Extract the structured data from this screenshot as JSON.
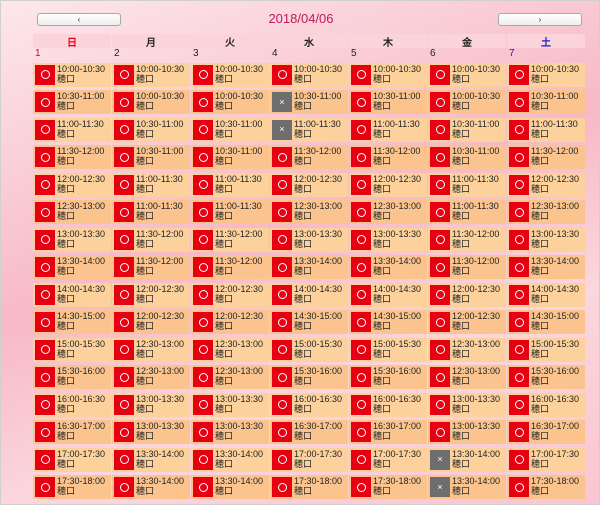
{
  "nav": {
    "prev_label": "‹",
    "next_label": "›"
  },
  "title": "2018/04/06",
  "colors": {
    "available": "#e60012",
    "unavailable": "#6e6e6e",
    "slot_bg": "#fdd19c",
    "header_bg": "#fbd4d9"
  },
  "days": [
    {
      "weekday": "日",
      "date": "1",
      "kind": "sun",
      "slots": [
        {
          "time": "10:00-10:30",
          "location": "穂口",
          "available": true
        },
        {
          "time": "10:30-11:00",
          "location": "穂口",
          "available": true
        },
        {
          "time": "11:00-11:30",
          "location": "穂口",
          "available": true
        },
        {
          "time": "11:30-12:00",
          "location": "穂口",
          "available": true
        },
        {
          "time": "12:00-12:30",
          "location": "穂口",
          "available": true
        },
        {
          "time": "12:30-13:00",
          "location": "穂口",
          "available": true
        },
        {
          "time": "13:00-13:30",
          "location": "穂口",
          "available": true
        },
        {
          "time": "13:30-14:00",
          "location": "穂口",
          "available": true
        },
        {
          "time": "14:00-14:30",
          "location": "穂口",
          "available": true
        },
        {
          "time": "14:30-15:00",
          "location": "穂口",
          "available": true
        },
        {
          "time": "15:00-15:30",
          "location": "穂口",
          "available": true
        },
        {
          "time": "15:30-16:00",
          "location": "穂口",
          "available": true
        },
        {
          "time": "16:00-16:30",
          "location": "穂口",
          "available": true
        },
        {
          "time": "16:30-17:00",
          "location": "穂口",
          "available": true
        },
        {
          "time": "17:00-17:30",
          "location": "穂口",
          "available": true
        },
        {
          "time": "17:30-18:00",
          "location": "穂口",
          "available": true
        }
      ]
    },
    {
      "weekday": "月",
      "date": "2",
      "kind": "wd",
      "slots": [
        {
          "time": "10:00-10:30",
          "location": "穂口",
          "available": true
        },
        {
          "time": "10:00-10:30",
          "location": "穂口",
          "available": true
        },
        {
          "time": "10:30-11:00",
          "location": "穂口",
          "available": true
        },
        {
          "time": "10:30-11:00",
          "location": "穂口",
          "available": true
        },
        {
          "time": "11:00-11:30",
          "location": "穂口",
          "available": true
        },
        {
          "time": "11:00-11:30",
          "location": "穂口",
          "available": true
        },
        {
          "time": "11:30-12:00",
          "location": "穂口",
          "available": true
        },
        {
          "time": "11:30-12:00",
          "location": "穂口",
          "available": true
        },
        {
          "time": "12:00-12:30",
          "location": "穂口",
          "available": true
        },
        {
          "time": "12:00-12:30",
          "location": "穂口",
          "available": true
        },
        {
          "time": "12:30-13:00",
          "location": "穂口",
          "available": true
        },
        {
          "time": "12:30-13:00",
          "location": "穂口",
          "available": true
        },
        {
          "time": "13:00-13:30",
          "location": "穂口",
          "available": true
        },
        {
          "time": "13:00-13:30",
          "location": "穂口",
          "available": true
        },
        {
          "time": "13:30-14:00",
          "location": "穂口",
          "available": true
        },
        {
          "time": "13:30-14:00",
          "location": "穂口",
          "available": true
        }
      ]
    },
    {
      "weekday": "火",
      "date": "3",
      "kind": "wd",
      "slots": [
        {
          "time": "10:00-10:30",
          "location": "穂口",
          "available": true
        },
        {
          "time": "10:00-10:30",
          "location": "穂口",
          "available": true
        },
        {
          "time": "10:30-11:00",
          "location": "穂口",
          "available": true
        },
        {
          "time": "10:30-11:00",
          "location": "穂口",
          "available": true
        },
        {
          "time": "11:00-11:30",
          "location": "穂口",
          "available": true
        },
        {
          "time": "11:00-11:30",
          "location": "穂口",
          "available": true
        },
        {
          "time": "11:30-12:00",
          "location": "穂口",
          "available": true
        },
        {
          "time": "11:30-12:00",
          "location": "穂口",
          "available": true
        },
        {
          "time": "12:00-12:30",
          "location": "穂口",
          "available": true
        },
        {
          "time": "12:00-12:30",
          "location": "穂口",
          "available": true
        },
        {
          "time": "12:30-13:00",
          "location": "穂口",
          "available": true
        },
        {
          "time": "12:30-13:00",
          "location": "穂口",
          "available": true
        },
        {
          "time": "13:00-13:30",
          "location": "穂口",
          "available": true
        },
        {
          "time": "13:00-13:30",
          "location": "穂口",
          "available": true
        },
        {
          "time": "13:30-14:00",
          "location": "穂口",
          "available": true
        },
        {
          "time": "13:30-14:00",
          "location": "穂口",
          "available": true
        }
      ]
    },
    {
      "weekday": "水",
      "date": "4",
      "kind": "wd",
      "slots": [
        {
          "time": "10:00-10:30",
          "location": "穂口",
          "available": true
        },
        {
          "time": "10:30-11:00",
          "location": "穂口",
          "available": false
        },
        {
          "time": "11:00-11:30",
          "location": "穂口",
          "available": false
        },
        {
          "time": "11:30-12:00",
          "location": "穂口",
          "available": true
        },
        {
          "time": "12:00-12:30",
          "location": "穂口",
          "available": true
        },
        {
          "time": "12:30-13:00",
          "location": "穂口",
          "available": true
        },
        {
          "time": "13:00-13:30",
          "location": "穂口",
          "available": true
        },
        {
          "time": "13:30-14:00",
          "location": "穂口",
          "available": true
        },
        {
          "time": "14:00-14:30",
          "location": "穂口",
          "available": true
        },
        {
          "time": "14:30-15:00",
          "location": "穂口",
          "available": true
        },
        {
          "time": "15:00-15:30",
          "location": "穂口",
          "available": true
        },
        {
          "time": "15:30-16:00",
          "location": "穂口",
          "available": true
        },
        {
          "time": "16:00-16:30",
          "location": "穂口",
          "available": true
        },
        {
          "time": "16:30-17:00",
          "location": "穂口",
          "available": true
        },
        {
          "time": "17:00-17:30",
          "location": "穂口",
          "available": true
        },
        {
          "time": "17:30-18:00",
          "location": "穂口",
          "available": true
        }
      ]
    },
    {
      "weekday": "木",
      "date": "5",
      "kind": "wd",
      "slots": [
        {
          "time": "10:00-10:30",
          "location": "穂口",
          "available": true
        },
        {
          "time": "10:30-11:00",
          "location": "穂口",
          "available": true
        },
        {
          "time": "11:00-11:30",
          "location": "穂口",
          "available": true
        },
        {
          "time": "11:30-12:00",
          "location": "穂口",
          "available": true
        },
        {
          "time": "12:00-12:30",
          "location": "穂口",
          "available": true
        },
        {
          "time": "12:30-13:00",
          "location": "穂口",
          "available": true
        },
        {
          "time": "13:00-13:30",
          "location": "穂口",
          "available": true
        },
        {
          "time": "13:30-14:00",
          "location": "穂口",
          "available": true
        },
        {
          "time": "14:00-14:30",
          "location": "穂口",
          "available": true
        },
        {
          "time": "14:30-15:00",
          "location": "穂口",
          "available": true
        },
        {
          "time": "15:00-15:30",
          "location": "穂口",
          "available": true
        },
        {
          "time": "15:30-16:00",
          "location": "穂口",
          "available": true
        },
        {
          "time": "16:00-16:30",
          "location": "穂口",
          "available": true
        },
        {
          "time": "16:30-17:00",
          "location": "穂口",
          "available": true
        },
        {
          "time": "17:00-17:30",
          "location": "穂口",
          "available": true
        },
        {
          "time": "17:30-18:00",
          "location": "穂口",
          "available": true
        }
      ]
    },
    {
      "weekday": "金",
      "date": "6",
      "kind": "wd",
      "slots": [
        {
          "time": "10:00-10:30",
          "location": "穂口",
          "available": true
        },
        {
          "time": "10:00-10:30",
          "location": "穂口",
          "available": true
        },
        {
          "time": "10:30-11:00",
          "location": "穂口",
          "available": true
        },
        {
          "time": "10:30-11:00",
          "location": "穂口",
          "available": true
        },
        {
          "time": "11:00-11:30",
          "location": "穂口",
          "available": true
        },
        {
          "time": "11:00-11:30",
          "location": "穂口",
          "available": true
        },
        {
          "time": "11:30-12:00",
          "location": "穂口",
          "available": true
        },
        {
          "time": "11:30-12:00",
          "location": "穂口",
          "available": true
        },
        {
          "time": "12:00-12:30",
          "location": "穂口",
          "available": true
        },
        {
          "time": "12:00-12:30",
          "location": "穂口",
          "available": true
        },
        {
          "time": "12:30-13:00",
          "location": "穂口",
          "available": true
        },
        {
          "time": "12:30-13:00",
          "location": "穂口",
          "available": true
        },
        {
          "time": "13:00-13:30",
          "location": "穂口",
          "available": true
        },
        {
          "time": "13:00-13:30",
          "location": "穂口",
          "available": true
        },
        {
          "time": "13:30-14:00",
          "location": "穂口",
          "available": false
        },
        {
          "time": "13:30-14:00",
          "location": "穂口",
          "available": false
        }
      ]
    },
    {
      "weekday": "土",
      "date": "7",
      "kind": "sat",
      "slots": [
        {
          "time": "10:00-10:30",
          "location": "穂口",
          "available": true
        },
        {
          "time": "10:30-11:00",
          "location": "穂口",
          "available": true
        },
        {
          "time": "11:00-11:30",
          "location": "穂口",
          "available": true
        },
        {
          "time": "11:30-12:00",
          "location": "穂口",
          "available": true
        },
        {
          "time": "12:00-12:30",
          "location": "穂口",
          "available": true
        },
        {
          "time": "12:30-13:00",
          "location": "穂口",
          "available": true
        },
        {
          "time": "13:00-13:30",
          "location": "穂口",
          "available": true
        },
        {
          "time": "13:30-14:00",
          "location": "穂口",
          "available": true
        },
        {
          "time": "14:00-14:30",
          "location": "穂口",
          "available": true
        },
        {
          "time": "14:30-15:00",
          "location": "穂口",
          "available": true
        },
        {
          "time": "15:00-15:30",
          "location": "穂口",
          "available": true
        },
        {
          "time": "15:30-16:00",
          "location": "穂口",
          "available": true
        },
        {
          "time": "16:00-16:30",
          "location": "穂口",
          "available": true
        },
        {
          "time": "16:30-17:00",
          "location": "穂口",
          "available": true
        },
        {
          "time": "17:00-17:30",
          "location": "穂口",
          "available": true
        },
        {
          "time": "17:30-18:00",
          "location": "穂口",
          "available": true
        }
      ]
    }
  ]
}
